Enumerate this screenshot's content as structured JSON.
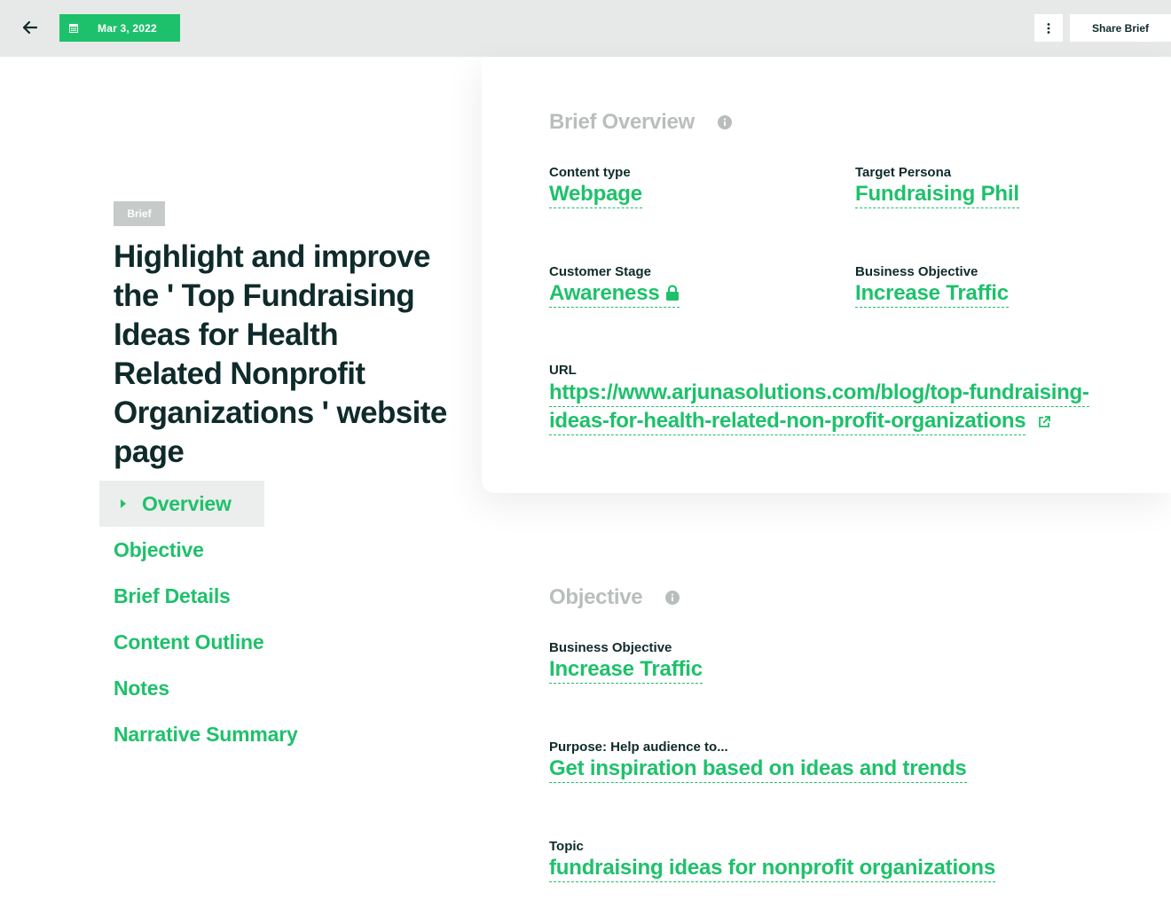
{
  "topbar": {
    "date": "Mar 3, 2022",
    "share_label": "Share Brief"
  },
  "brief": {
    "badge": "Brief",
    "title": "Highlight and improve the ' Top Fundraising Ideas for Health Related Nonprofit Organizations ' website page"
  },
  "nav": {
    "items": [
      {
        "label": "Overview",
        "active": true
      },
      {
        "label": "Objective"
      },
      {
        "label": "Brief Details"
      },
      {
        "label": "Content Outline"
      },
      {
        "label": "Notes"
      },
      {
        "label": "Narrative Summary"
      }
    ]
  },
  "overview": {
    "title": "Brief Overview",
    "content_type_label": "Content type",
    "content_type_value": "Webpage",
    "persona_label": "Target Persona",
    "persona_value": "Fundraising Phil",
    "stage_label": "Customer Stage",
    "stage_value": "Awareness",
    "biz_obj_label": "Business Objective",
    "biz_obj_value": "Increase Traffic",
    "url_label": "URL",
    "url_line1": "https://www.arjunasolutions.com/blog/top-fundraising-",
    "url_line2": "ideas-for-health-related-non-profit-organizations"
  },
  "objective": {
    "title": "Objective",
    "biz_obj_label": "Business Objective",
    "biz_obj_value": "Increase Traffic",
    "purpose_label": "Purpose: Help audience to...",
    "purpose_value": "Get inspiration based on ideas and trends",
    "topic_label": "Topic",
    "topic_value": "fundraising ideas for nonprofit organizations"
  },
  "colors": {
    "accent": "#1ec16b",
    "topbar": "#e6e9e8",
    "text": "#0f2a2a",
    "muted": "#b9bebd"
  }
}
